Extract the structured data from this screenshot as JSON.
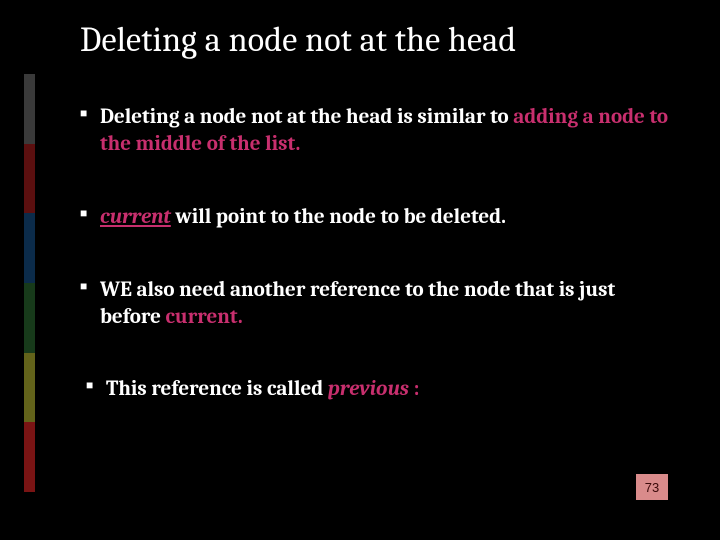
{
  "title": "Deleting a node not at the head",
  "bullets": {
    "b1": {
      "part1": "Deleting a node not at the head is similar to ",
      "accent": "adding a node to the middle of the list."
    },
    "b2": {
      "accent_italic": "current",
      "accent_rest": " ",
      "rest": "will  point to the node to be deleted."
    },
    "b3": {
      "part1": "WE also need another reference  to the node that is just before ",
      "accent": "current."
    },
    "b4": {
      "lead": " This reference is called ",
      "accent_italic": "previous",
      "tail": " :"
    }
  },
  "page_number": "73"
}
